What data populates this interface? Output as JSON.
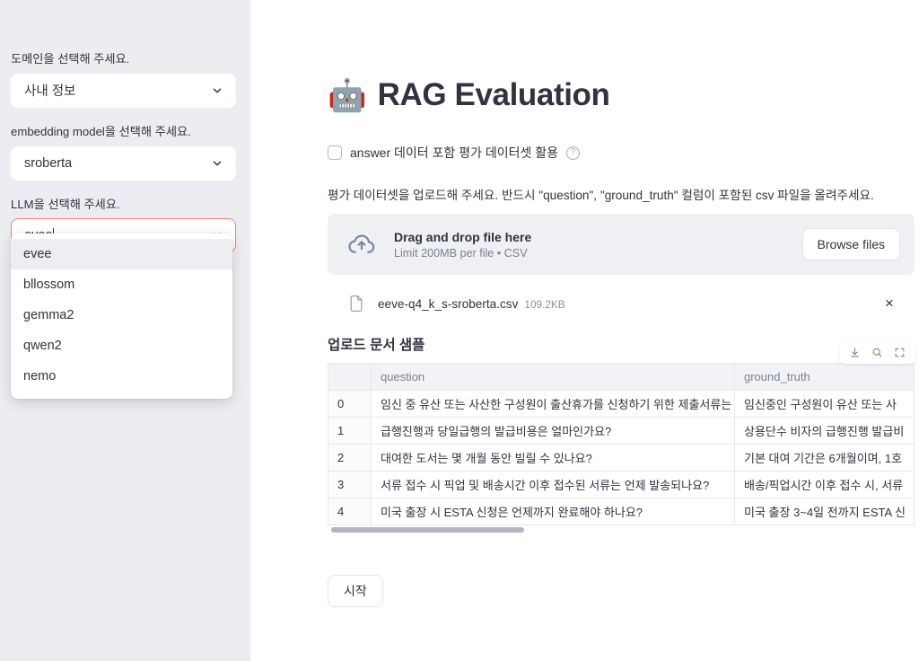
{
  "sidebar": {
    "fields": [
      {
        "label": "도메인을 선택해 주세요.",
        "value": "사내 정보",
        "name": "domain"
      },
      {
        "label": "embedding model을 선택해 주세요.",
        "value": "sroberta",
        "name": "embedding-model"
      },
      {
        "label": "LLM을 선택해 주세요.",
        "value": "evee",
        "name": "llm"
      }
    ],
    "llm_options": [
      "evee",
      "bllossom",
      "gemma2",
      "qwen2",
      "nemo"
    ],
    "llm_selected_option": "evee"
  },
  "main": {
    "emoji": "🤖",
    "title": "RAG Evaluation",
    "checkbox": {
      "label": "answer 데이터 포함 평가 데이터셋 활용",
      "checked": false,
      "help_icon": "help-circle-icon"
    },
    "instruction": "평가 데이터셋을 업로드해 주세요. 반드시 \"question\", \"ground_truth\" 컬럼이 포함된 csv 파일을 올려주세요.",
    "dropzone": {
      "icon": "cloud-upload-icon",
      "title": "Drag and drop file here",
      "subtitle": "Limit 200MB per file • CSV",
      "browse_label": "Browse files"
    },
    "uploaded_file": {
      "icon": "file-icon",
      "name": "eeve-q4_k_s-sroberta.csv",
      "size": "109.2KB",
      "remove_label": "×"
    },
    "table_section": {
      "heading": "업로드 문서 샘플",
      "toolbar_icons": [
        "download-icon",
        "search-icon",
        "fullscreen-icon"
      ],
      "columns": [
        "",
        "question",
        "ground_truth"
      ],
      "rows": [
        {
          "index": "0",
          "question": "임신 중 유산 또는 사산한 구성원이 출산휴가를 신청하기 위한 제출서류는 무엇인가요?",
          "ground_truth": "임신중인 구성원이 유산 또는 사"
        },
        {
          "index": "1",
          "question": "급행진행과 당일급행의 발급비용은 얼마인가요?",
          "ground_truth": "상용단수 비자의 급행진행 발급비"
        },
        {
          "index": "2",
          "question": "대여한 도서는 몇 개월 동안 빌릴 수 있나요?",
          "ground_truth": "기본 대여 기간은 6개월이며, 1호"
        },
        {
          "index": "3",
          "question": "서류 접수 시 픽업 및 배송시간 이후 접수된 서류는 언제 발송되나요?",
          "ground_truth": "배송/픽업시간 이후 접수 시, 서류"
        },
        {
          "index": "4",
          "question": "미국 출장 시 ESTA 신청은 언제까지 완료해야 하나요?",
          "ground_truth": "미국 출장 3~4일 전까지 ESTA 신"
        }
      ]
    },
    "start_button": "시작"
  },
  "colors": {
    "sidebar_bg": "#ecedf1",
    "focus_border": "#ff7a77",
    "text": "#31333f",
    "muted": "#7d8090"
  }
}
